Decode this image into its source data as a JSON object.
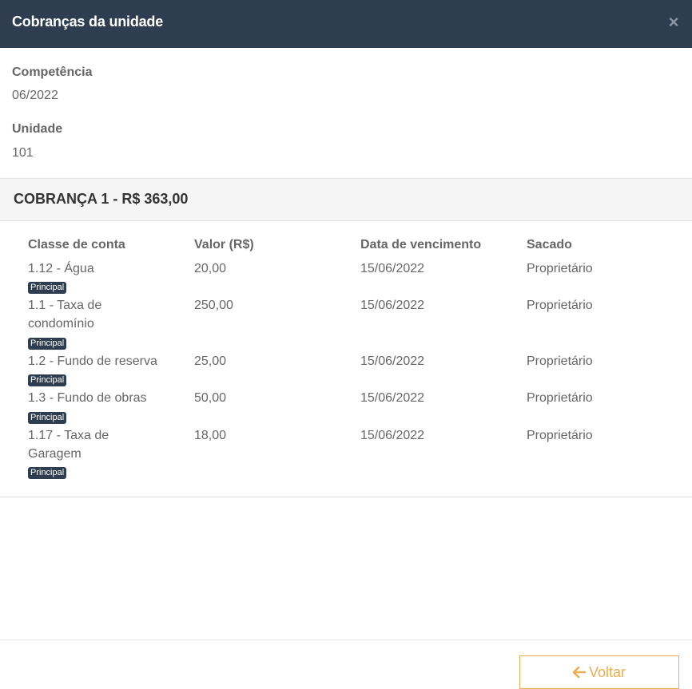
{
  "modal": {
    "title": "Cobranças da unidade",
    "close_glyph": "×"
  },
  "info": {
    "competencia_label": "Competência",
    "competencia_value": "06/2022",
    "unidade_label": "Unidade",
    "unidade_value": "101"
  },
  "charge": {
    "title": "COBRANÇA 1 - R$ 363,00",
    "columns": [
      "Classe de conta",
      "Valor (R$)",
      "Data de vencimento",
      "Sacado"
    ],
    "rows": [
      {
        "classe": "1.12 - Água",
        "valor": "20,00",
        "vencimento": "15/06/2022",
        "sacado": "Proprietário",
        "badge": "Principal"
      },
      {
        "classe": "1.1 - Taxa de condomínio",
        "valor": "250,00",
        "vencimento": "15/06/2022",
        "sacado": "Proprietário",
        "badge": "Principal"
      },
      {
        "classe": "1.2 - Fundo de reserva",
        "valor": "25,00",
        "vencimento": "15/06/2022",
        "sacado": "Proprietário",
        "badge": "Principal"
      },
      {
        "classe": "1.3 - Fundo de obras",
        "valor": "50,00",
        "vencimento": "15/06/2022",
        "sacado": "Proprietário",
        "badge": "Principal"
      },
      {
        "classe": "1.17 - Taxa de Garagem",
        "valor": "18,00",
        "vencimento": "15/06/2022",
        "sacado": "Proprietário",
        "badge": "Principal"
      }
    ]
  },
  "footer": {
    "back_label": "Voltar",
    "back_icon": "arrow-left-icon"
  },
  "colors": {
    "header_bg": "#2e3e50",
    "badge_bg": "#2e3e50",
    "accent": "#f0ad4e"
  }
}
